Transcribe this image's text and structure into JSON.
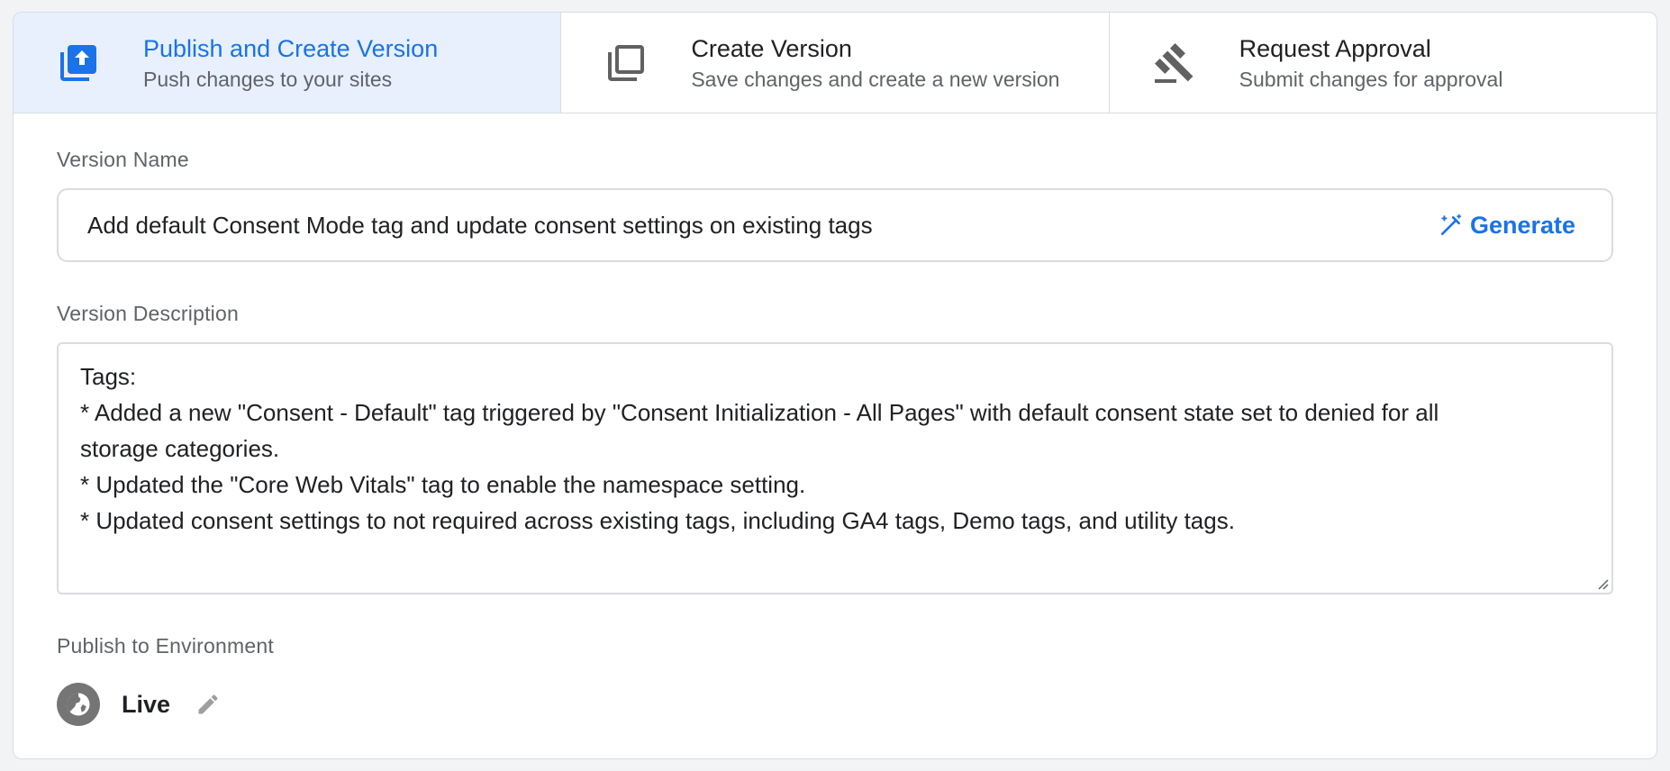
{
  "options": [
    {
      "title": "Publish and Create Version",
      "subtitle": "Push changes to your sites",
      "icon": "publish-upload-icon",
      "selected": true
    },
    {
      "title": "Create Version",
      "subtitle": "Save changes and create a new version",
      "icon": "copy-version-icon",
      "selected": false
    },
    {
      "title": "Request Approval",
      "subtitle": "Submit changes for approval",
      "icon": "gavel-icon",
      "selected": false
    }
  ],
  "version_name": {
    "label": "Version Name",
    "value": "Add default Consent Mode tag and update consent settings on existing tags",
    "generate_label": "Generate"
  },
  "version_description": {
    "label": "Version Description",
    "lines": [
      "Tags:",
      "* Added a new \"Consent - Default\" tag triggered by \"Consent Initialization - All Pages\" with default consent state set to denied for all",
      "storage categories.",
      "* Updated the \"Core Web Vitals\" tag to enable the namespace setting.",
      "* Updated consent settings to not required across existing tags, including GA4 tags, Demo tags, and utility tags."
    ]
  },
  "environment": {
    "label": "Publish to Environment",
    "name": "Live"
  },
  "colors": {
    "accent": "#1a73e8",
    "selected_bg": "#e8f0fe",
    "icon_gray": "#757575"
  }
}
